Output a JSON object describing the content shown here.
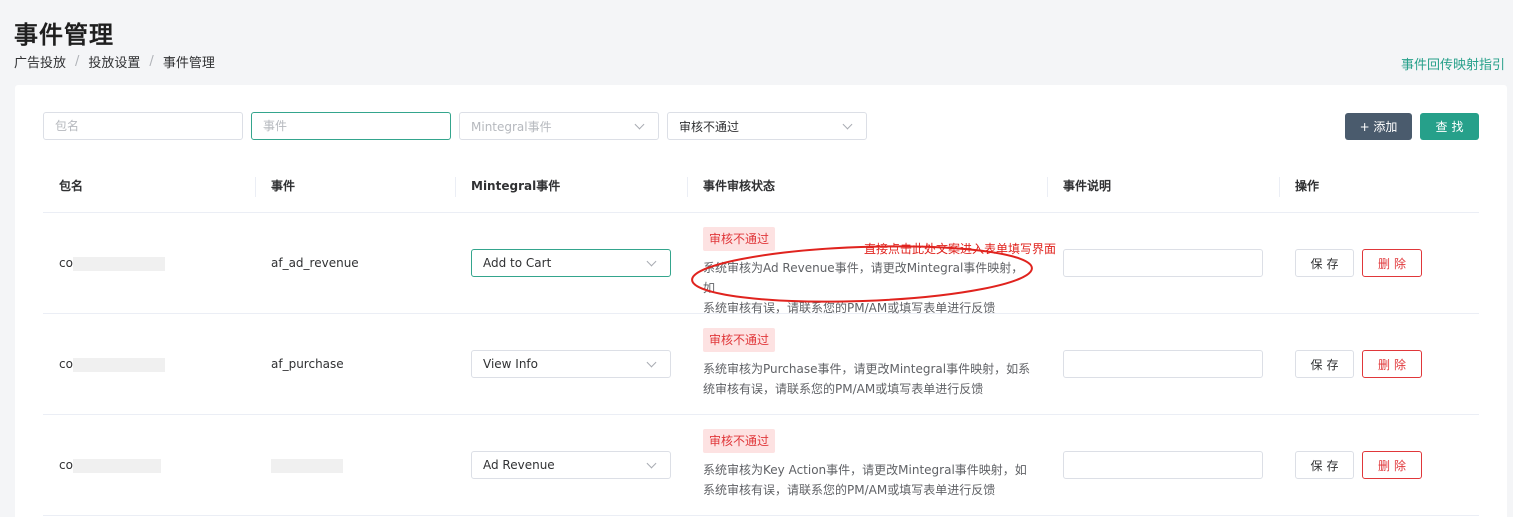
{
  "page": {
    "title": "事件管理"
  },
  "breadcrumb": {
    "items": [
      "广告投放",
      "投放设置",
      "事件管理"
    ],
    "separator": "/"
  },
  "guide_link": "事件回传映射指引",
  "filters": {
    "package": {
      "placeholder": "包名",
      "value": ""
    },
    "event": {
      "placeholder": "事件",
      "value": ""
    },
    "mintegral_event": {
      "placeholder": "Mintegral事件",
      "value": ""
    },
    "review_status": {
      "value": "审核不通过"
    }
  },
  "buttons": {
    "add": "+ 添加",
    "search": "查找"
  },
  "table": {
    "headers": [
      "包名",
      "事件",
      "Mintegral事件",
      "事件审核状态",
      "事件说明",
      "操作"
    ],
    "rows": [
      {
        "package_prefix": "co",
        "event": "af_ad_revenue",
        "mintegral_event": "Add to Cart",
        "status": "审核不通过",
        "desc_line1": "系统审核为Ad Revenue事件，请更改Mintegral事件映射，如",
        "desc_line2": "系统审核有误，请联系您的PM/AM或填写表单进行反馈",
        "description_value": "",
        "save": "保存",
        "delete": "删除"
      },
      {
        "package_prefix": "co",
        "event": "af_purchase",
        "mintegral_event": "View Info",
        "status": "审核不通过",
        "desc_line1": "系统审核为Purchase事件，请更改Mintegral事件映射，如系",
        "desc_line2": "统审核有误，请联系您的PM/AM或填写表单进行反馈",
        "description_value": "",
        "save": "保存",
        "delete": "删除"
      },
      {
        "package_prefix": "co",
        "event": "",
        "mintegral_event": "Ad Revenue",
        "status": "审核不通过",
        "desc_line1": "系统审核为Key Action事件，请更改Mintegral事件映射，如",
        "desc_line2": "系统审核有误，请联系您的PM/AM或填写表单进行反馈",
        "description_value": "",
        "save": "保存",
        "delete": "删除"
      }
    ]
  },
  "annotation": {
    "text": "直接点击此处文案进入表单填写界面",
    "color": "#e0231e"
  },
  "colors": {
    "primary": "#26a08a",
    "dark_button": "#4a5b6d",
    "danger": "#e0373a",
    "danger_bg": "#fde2e2"
  }
}
